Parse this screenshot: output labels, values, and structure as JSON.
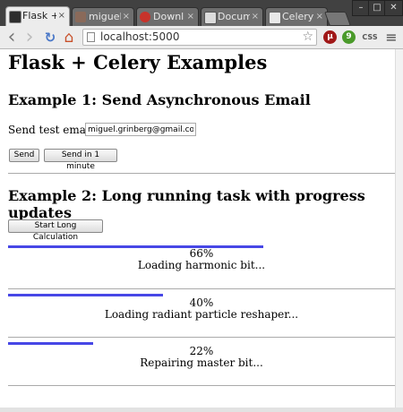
{
  "tabs": [
    {
      "title": "Flask +",
      "active": true,
      "favicon": "terminal-icon"
    },
    {
      "title": "miguel",
      "active": false,
      "favicon": "avatar-icon"
    },
    {
      "title": "Downl",
      "active": false,
      "favicon": "download-icon"
    },
    {
      "title": "Docum",
      "active": false,
      "favicon": "docs-icon"
    },
    {
      "title": "Celery",
      "active": false,
      "favicon": "page-icon"
    }
  ],
  "tab_close": "×",
  "window_controls": {
    "minimize": "–",
    "maximize": "□",
    "close": "✕"
  },
  "toolbar": {
    "url": "localhost:5000",
    "back_icon": "‹",
    "forward_icon": "›",
    "reload_icon": "↻",
    "home_icon": "⌂",
    "star_icon": "☆",
    "menu_icon": "≡",
    "extensions": [
      {
        "name": "ublock-icon",
        "label": "μ",
        "color": "#a01818"
      },
      {
        "name": "evernote-icon",
        "label": "9",
        "color": "#4a9a2a"
      },
      {
        "name": "css-icon",
        "label": "CSS",
        "color": "#555555"
      }
    ]
  },
  "page": {
    "title": "Flask + Celery Examples",
    "example1": {
      "heading": "Example 1: Send Asynchronous Email",
      "label": "Send test email to:",
      "email_value": "miguel.grinberg@gmail.com",
      "send_label": "Send",
      "send_later_label": "Send in 1 minute"
    },
    "example2": {
      "heading": "Example 2: Long running task with progress updates",
      "start_label": "Start Long Calculation",
      "tasks": [
        {
          "percent": 66,
          "percent_text": "66%",
          "status": "Loading harmonic bit..."
        },
        {
          "percent": 40,
          "percent_text": "40%",
          "status": "Loading radiant particle reshaper..."
        },
        {
          "percent": 22,
          "percent_text": "22%",
          "status": "Repairing master bit..."
        }
      ]
    }
  },
  "colors": {
    "progress": "#4747e6"
  }
}
